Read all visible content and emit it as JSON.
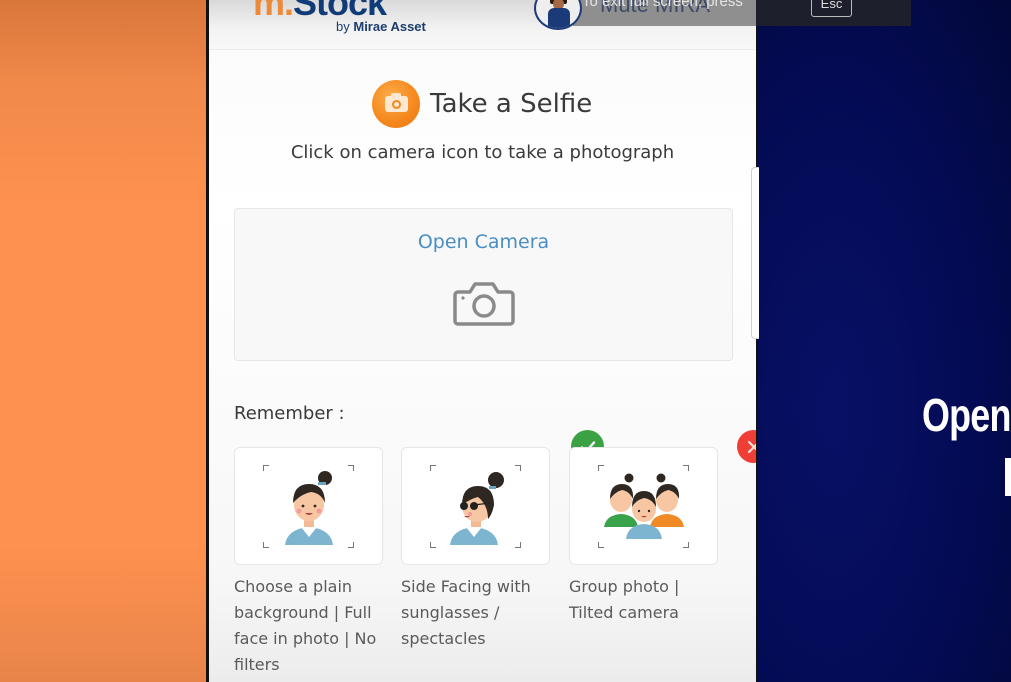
{
  "app": {
    "brand": {
      "logo_prefix": "m.",
      "logo_name": "Stock",
      "logo_sub_prefix": "by",
      "logo_sub_company": "Mirae Asset",
      "colors": {
        "orange": "#ec8a3a",
        "navy": "#0f3c78"
      }
    },
    "assistant": {
      "mute_label": "Mute MIRA"
    },
    "fullscreen_hint": {
      "text": "To exit full screen, press",
      "key": "Esc"
    }
  },
  "page": {
    "title": "Take a Selfie",
    "title_icon": "camera-icon",
    "subtitle": "Click on camera icon to take a photograph",
    "camera_box": {
      "label": "Open Camera",
      "icon": "camera-outline-icon",
      "label_color": "#4a8ec4"
    },
    "remember_label": "Remember :",
    "examples": [
      {
        "status": "correct",
        "badge_icon": "check-icon",
        "image": "woman-front-facing",
        "caption": "Choose a plain background | Full face in photo | No filters"
      },
      {
        "status": "incorrect",
        "badge_icon": "close-icon",
        "image": "woman-side-sunglasses",
        "caption": "Side Facing with sunglasses / spectacles"
      },
      {
        "status": "incorrect",
        "badge_icon": "close-icon",
        "image": "group-photo",
        "caption": "Group photo | Tilted camera"
      }
    ],
    "status_colors": {
      "correct": "#3aa243",
      "incorrect": "#ef3e36"
    }
  },
  "background": {
    "left_color": "#fe914f",
    "right_color": "#040b55",
    "promo_text": "Open"
  }
}
